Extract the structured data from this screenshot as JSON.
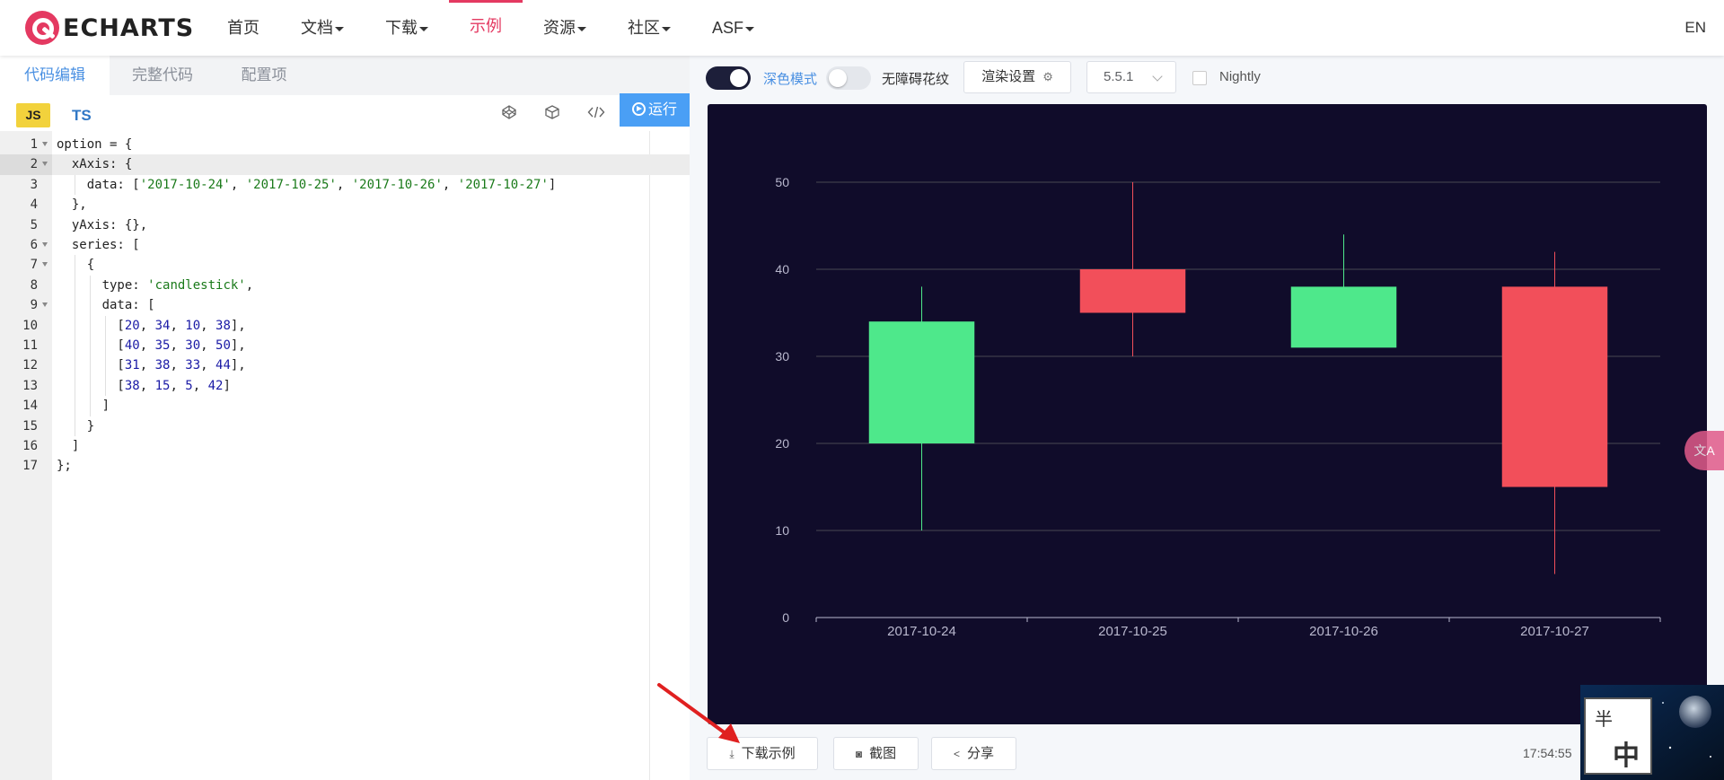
{
  "nav": {
    "logo_text": "ECHARTS",
    "items": [
      {
        "label": "首页",
        "dropdown": false,
        "active": false
      },
      {
        "label": "文档",
        "dropdown": true,
        "active": false
      },
      {
        "label": "下载",
        "dropdown": true,
        "active": false
      },
      {
        "label": "示例",
        "dropdown": false,
        "active": true
      },
      {
        "label": "资源",
        "dropdown": true,
        "active": false
      },
      {
        "label": "社区",
        "dropdown": true,
        "active": false
      },
      {
        "label": "ASF",
        "dropdown": true,
        "active": false
      }
    ],
    "lang": "EN"
  },
  "editor": {
    "tabs": [
      "代码编辑",
      "完整代码",
      "配置项"
    ],
    "active_tab": 0,
    "js_label": "JS",
    "ts_label": "TS",
    "run_label": "运行",
    "highlight_line": 2,
    "lines": [
      {
        "n": "1",
        "fold": true
      },
      {
        "n": "2",
        "fold": true
      },
      {
        "n": "3",
        "fold": false
      },
      {
        "n": "4",
        "fold": false
      },
      {
        "n": "5",
        "fold": false
      },
      {
        "n": "6",
        "fold": true
      },
      {
        "n": "7",
        "fold": true
      },
      {
        "n": "8",
        "fold": false
      },
      {
        "n": "9",
        "fold": true
      },
      {
        "n": "10",
        "fold": false
      },
      {
        "n": "11",
        "fold": false
      },
      {
        "n": "12",
        "fold": false
      },
      {
        "n": "13",
        "fold": false
      },
      {
        "n": "14",
        "fold": false
      },
      {
        "n": "15",
        "fold": false
      },
      {
        "n": "16",
        "fold": false
      },
      {
        "n": "17",
        "fold": false
      }
    ],
    "code": [
      "option = {",
      "  xAxis: {",
      "    data: ['2017-10-24', '2017-10-25', '2017-10-26', '2017-10-27']",
      "  },",
      "  yAxis: {},",
      "  series: [",
      "    {",
      "      type: 'candlestick',",
      "      data: [",
      "        [20, 34, 10, 38],",
      "        [40, 35, 30, 50],",
      "        [31, 38, 33, 44],",
      "        [38, 15, 5, 42]",
      "      ]",
      "    }",
      "  ]",
      "};"
    ]
  },
  "preview": {
    "dark_mode_label": "深色模式",
    "dark_mode_on": true,
    "aria_label": "无障碍花纹",
    "aria_on": false,
    "render_settings_label": "渲染设置",
    "version": "5.5.1",
    "nightly_label": "Nightly",
    "download_label": "下载示例",
    "screenshot_label": "截图",
    "share_label": "分享",
    "timestamp": "17:54:55"
  },
  "overlay": {
    "translate_label": "文A",
    "thumb_text_top": "半",
    "thumb_text_bottom": "中"
  },
  "colors": {
    "brand": "#e43961",
    "chart_bg": "#100c2a",
    "up": "#4ee88b",
    "down": "#f24f5a",
    "axis": "#b9b8ce",
    "grid": "#484753",
    "link": "#4a90e2"
  },
  "chart_data": {
    "type": "candlestick",
    "categories": [
      "2017-10-24",
      "2017-10-25",
      "2017-10-26",
      "2017-10-27"
    ],
    "series": [
      {
        "type": "candlestick",
        "values": [
          [
            20,
            34,
            10,
            38
          ],
          [
            40,
            35,
            30,
            50
          ],
          [
            31,
            38,
            33,
            44
          ],
          [
            38,
            15,
            5,
            42
          ]
        ]
      }
    ],
    "ylim": [
      0,
      50
    ],
    "yticks": [
      0,
      10,
      20,
      30,
      40,
      50
    ],
    "grid": true,
    "legend": "none"
  }
}
